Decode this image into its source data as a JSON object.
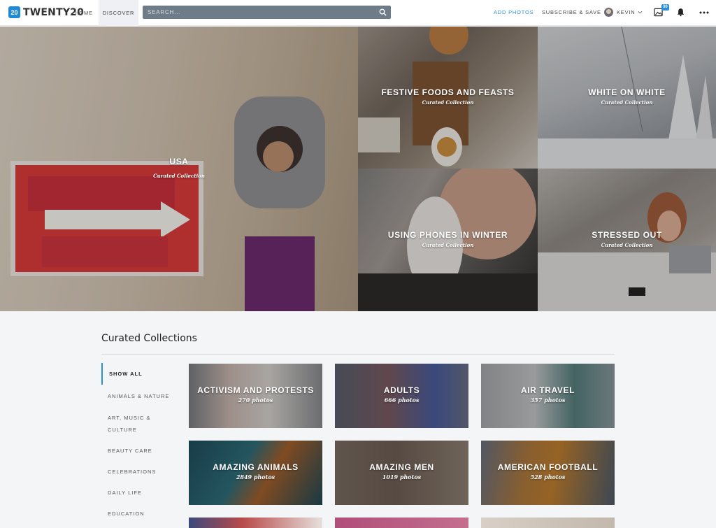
{
  "header": {
    "logo_mark": "20",
    "logo_text": "TWENTY20",
    "nav": {
      "home": "HOME",
      "discover": "DISCOVER"
    },
    "search": {
      "placeholder": "SEARCH..."
    },
    "add_photos": "ADD PHOTOS",
    "subscribe": "SUBSCRIBE & SAVE",
    "user": "KEVIN",
    "notifications_badge": "30"
  },
  "hero": [
    {
      "title": "USA",
      "subtitle": "Curated Collection"
    },
    {
      "title": "FESTIVE FOODS AND FEASTS",
      "subtitle": "Curated Collection"
    },
    {
      "title": "WHITE ON WHITE",
      "subtitle": "Curated Collection"
    },
    {
      "title": "USING PHONES IN WINTER",
      "subtitle": "Curated Collection"
    },
    {
      "title": "STRESSED OUT",
      "subtitle": "Curated Collection"
    }
  ],
  "section": {
    "title": "Curated Collections"
  },
  "sidebar": {
    "items": [
      {
        "label": "SHOW ALL"
      },
      {
        "label": "ANIMALS & NATURE"
      },
      {
        "label": "ART, MUSIC &"
      },
      {
        "label": "CULTURE"
      },
      {
        "label": "BEAUTY CARE"
      },
      {
        "label": "CELEBRATIONS"
      },
      {
        "label": "DAILY LIFE"
      },
      {
        "label": "EDUCATION"
      }
    ]
  },
  "collections": [
    {
      "title": "ACTIVISM AND PROTESTS",
      "count": "270 photos"
    },
    {
      "title": "ADULTS",
      "count": "666 photos"
    },
    {
      "title": "AIR TRAVEL",
      "count": "357 photos"
    },
    {
      "title": "AMAZING ANIMALS",
      "count": "2849 photos"
    },
    {
      "title": "AMAZING MEN",
      "count": "1019 photos"
    },
    {
      "title": "AMERICAN FOOTBALL",
      "count": "528 photos"
    }
  ],
  "colors": {
    "accent": "#2b8fd8",
    "search_bg": "#6e7b88",
    "page_bg": "#f4f5f7"
  }
}
